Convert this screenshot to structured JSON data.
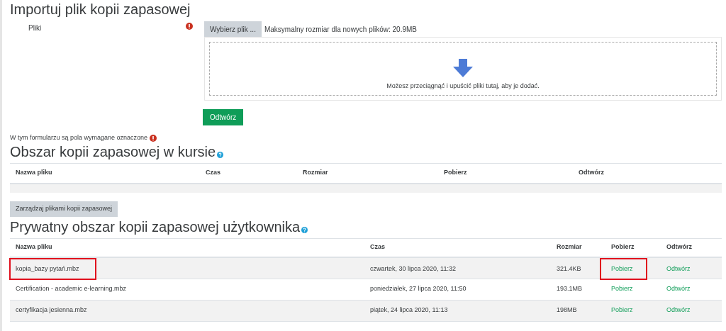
{
  "import_section": {
    "title": "Importuj plik kopii zapasowej",
    "field_label": "Pliki",
    "choose_button": "Wybierz plik ...",
    "max_size": "Maksymalny rozmiar dla nowych plików: 20.9MB",
    "drop_hint": "Możesz przeciągnąć i upuścić pliki tutaj, aby je dodać.",
    "submit_button": "Odtwórz",
    "required_note": "W tym formularzu są pola wymagane oznaczone"
  },
  "course_area": {
    "title": "Obszar kopii zapasowej w kursie",
    "columns": [
      "Nazwa pliku",
      "Czas",
      "Rozmiar",
      "Pobierz",
      "Odtwórz"
    ],
    "manage_button": "Zarządzaj plikami kopii zapasowej"
  },
  "user_area": {
    "title": "Prywatny obszar kopii zapasowej użytkownika",
    "columns": [
      "Nazwa pliku",
      "Czas",
      "Rozmiar",
      "Pobierz",
      "Odtwórz"
    ],
    "rows": [
      {
        "name": "kopia_bazy pytań.mbz",
        "time": "czwartek, 30 lipca 2020, 11:32",
        "size": "321.4KB",
        "download": "Pobierz",
        "restore": "Odtwórz",
        "highlighted": true
      },
      {
        "name": "Certification - academic e-learning.mbz",
        "time": "poniedziałek, 27 lipca 2020, 11:50",
        "size": "193.1MB",
        "download": "Pobierz",
        "restore": "Odtwórz",
        "highlighted": false
      },
      {
        "name": "certyfikacja jesienna.mbz",
        "time": "piątek, 24 lipca 2020, 11:13",
        "size": "198MB",
        "download": "Pobierz",
        "restore": "Odtwórz",
        "highlighted": false
      }
    ]
  }
}
